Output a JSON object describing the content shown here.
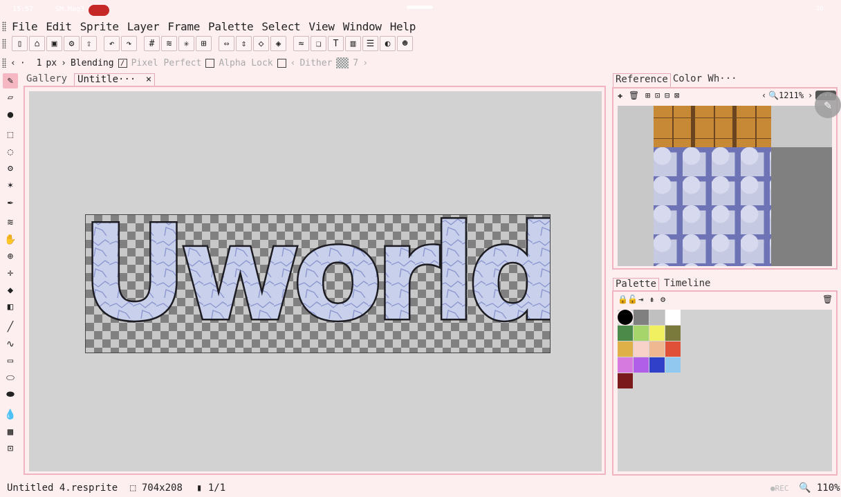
{
  "app": {
    "status_time": "15:57",
    "status_app": "SM.Mag3",
    "status_right": "20"
  },
  "menu": [
    "File",
    "Edit",
    "Sprite",
    "Layer",
    "Frame",
    "Palette",
    "Select",
    "View",
    "Window",
    "Help"
  ],
  "toolbar_icons": [
    "new-file-icon",
    "open-file-icon",
    "save-icon",
    "settings-icon",
    "export-icon",
    "undo-icon",
    "redo-icon",
    "grid-icon",
    "symmetry-icon",
    "tiled-icon",
    "pixel-grid-icon",
    "flip-h-icon",
    "flip-v-icon",
    "rotate-cw-icon",
    "rotate-ccw-icon",
    "adjust-icon",
    "layers-icon",
    "text-icon",
    "outline-icon",
    "align-icon",
    "contrast-icon",
    "palette-icon"
  ],
  "options": {
    "brush_size": "1",
    "brush_unit": "px",
    "blending": "Blending",
    "pixel_perfect": "Pixel Perfect",
    "alpha_lock": "Alpha Lock",
    "dither": "Dither",
    "dither_value": "7"
  },
  "tools": [
    "pencil-icon",
    "eraser-icon",
    "shading-icon",
    "rect-select-icon",
    "ellipse-select-icon",
    "lasso-icon",
    "magic-wand-icon",
    "eyedropper-icon",
    "move-layer-icon",
    "hand-icon",
    "zoom-icon",
    "crosshair-icon",
    "bucket-icon",
    "gradient-icon",
    "line-icon",
    "curve-icon",
    "rectangle-icon",
    "ellipse-icon",
    "filled-shape-icon",
    "smudge-icon",
    "dither-icon",
    "stamp-icon"
  ],
  "doc_tabs": [
    {
      "label": "Gallery"
    },
    {
      "label": "Untitle···",
      "close": "×"
    }
  ],
  "sprite_text": "Uworld",
  "reference": {
    "tabs": [
      "Reference",
      "Color Wh···"
    ],
    "zoom": "1211%"
  },
  "palette": {
    "tabs": [
      "Palette",
      "Timeline"
    ],
    "colors": [
      "#000000",
      "#808080",
      "#c0c0c0",
      "#ffffff",
      "#4b8a48",
      "#a6d66b",
      "#f0f060",
      "#7a7a3c",
      "#e0b048",
      "#f8d2c8",
      "#f0b890",
      "#e05038",
      "#d67ae0",
      "#b060e8",
      "#3040c8",
      "#90c8f0",
      "#7a1a1a"
    ]
  },
  "status": {
    "filename": "Untitled 4.resprite",
    "canvas_size": "704x208",
    "frames": "1/1",
    "rec": "●REC",
    "zoom": "110%"
  }
}
